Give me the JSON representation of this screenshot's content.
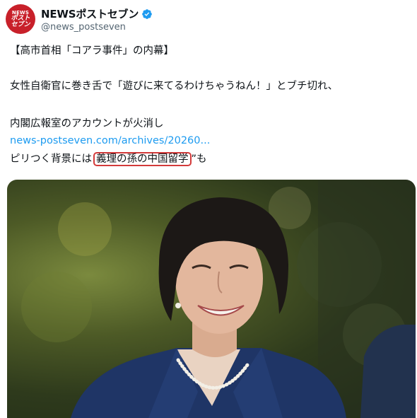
{
  "account": {
    "display_name": "NEWSポストセブン",
    "handle": "@news_postseven",
    "avatar_text": [
      "NEWS",
      "ポスト",
      "セブン"
    ],
    "verified": true,
    "avatar_color": "#c8202a"
  },
  "post": {
    "title": "【高市首相「コアラ事件」の内幕】",
    "line2": "女性自衛官に巻き舌で「遊びに来てるわけちゃうねん！」とブチ切れ、",
    "line3": "内閣広報室のアカウントが火消し",
    "link": "news-postseven.com/archives/20260...",
    "line5_prefix": "ピリつく背景には",
    "line5_highlight": "義理の孫の中国留学",
    "line5_suffix": "”も"
  },
  "colors": {
    "link": "#1d9bf0",
    "highlight_border": "#d33a3a",
    "verified_badge": "#1d9bf0"
  }
}
